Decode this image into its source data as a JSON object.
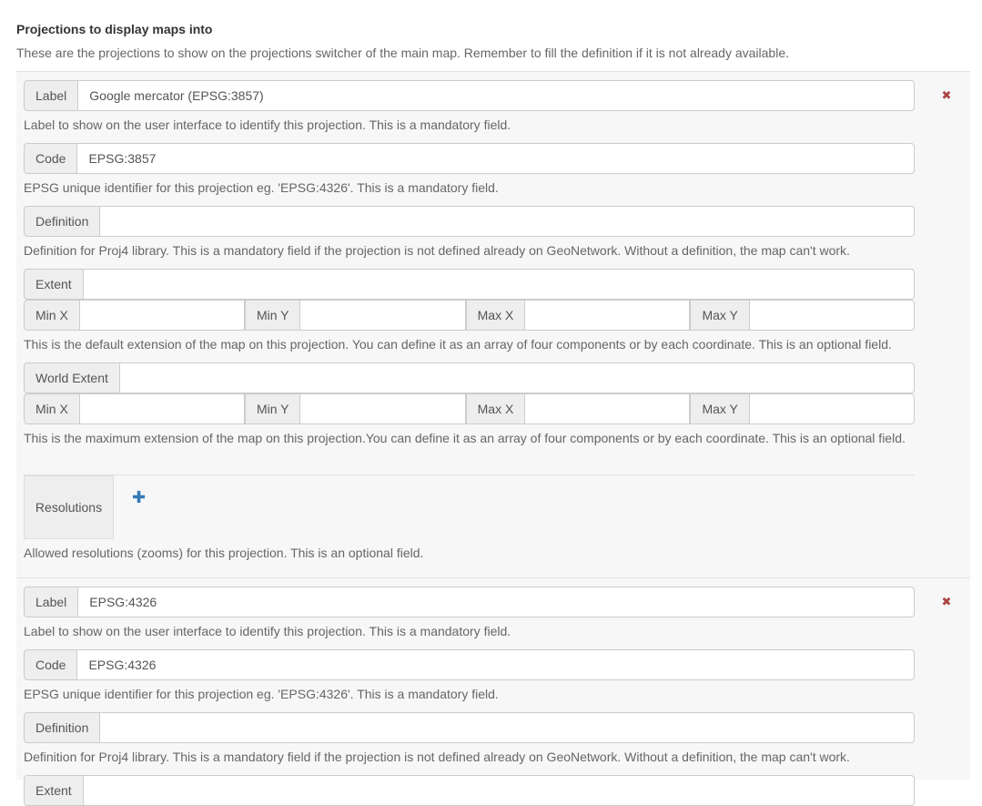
{
  "section": {
    "title": "Projections to display maps into",
    "description": "These are the projections to show on the projections switcher of the main map. Remember to fill the definition if it is not already available."
  },
  "labels": {
    "label": "Label",
    "code": "Code",
    "definition": "Definition",
    "extent": "Extent",
    "world_extent": "World Extent",
    "min_x": "Min X",
    "min_y": "Min Y",
    "max_x": "Max X",
    "max_y": "Max Y",
    "resolutions": "Resolutions"
  },
  "help": {
    "label": "Label to show on the user interface to identify this projection. This is a mandatory field.",
    "code": "EPSG unique identifier for this projection eg. 'EPSG:4326'. This is a mandatory field.",
    "definition": "Definition for Proj4 library. This is a mandatory field if the projection is not defined already on GeoNetwork. Without a definition, the map can't work.",
    "extent": "This is the default extension of the map on this projection. You can define it as an array of four components or by each coordinate. This is an optional field.",
    "world_extent": "This is the maximum extension of the map on this projection.You can define it as an array of four components or by each coordinate. This is an optional field.",
    "resolutions": "Allowed resolutions (zooms) for this projection. This is an optional field."
  },
  "icons": {
    "remove": "✖",
    "add": "✚"
  },
  "projections": [
    {
      "label_value": "Google mercator (EPSG:3857)",
      "code_value": "EPSG:3857",
      "definition_value": "",
      "extent_value": ""
    },
    {
      "label_value": "EPSG:4326",
      "code_value": "EPSG:4326",
      "definition_value": "",
      "extent_value": ""
    }
  ]
}
